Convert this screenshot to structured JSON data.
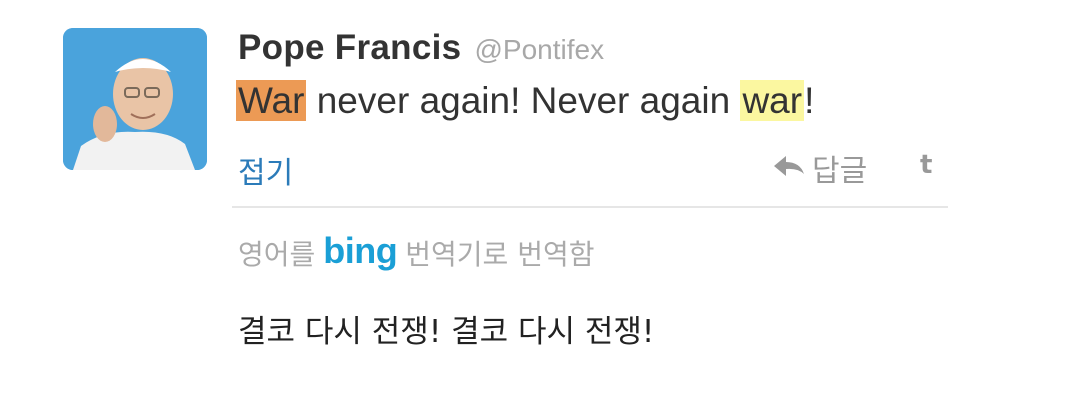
{
  "tweet": {
    "author_name": "Pope Francis",
    "author_handle": "@Pontifex",
    "text_parts": [
      "War",
      " never again! Never again ",
      "war",
      "!"
    ],
    "collapse_label": "접기",
    "reply_label": "답글",
    "retweet_label": "t",
    "translation": {
      "prefix": "영어를",
      "service": "bing",
      "suffix": "번역기로 번역함",
      "text": "결코 다시 전쟁! 결코 다시 전쟁!"
    }
  },
  "colors": {
    "highlight_orange": "#ec9a55",
    "highlight_yellow": "#fbf7a0",
    "link_blue": "#2b7bb9",
    "bing_blue": "#1a9fd6"
  },
  "icons": [
    "avatar-photo",
    "reply-arrow-icon",
    "retweet-icon"
  ]
}
